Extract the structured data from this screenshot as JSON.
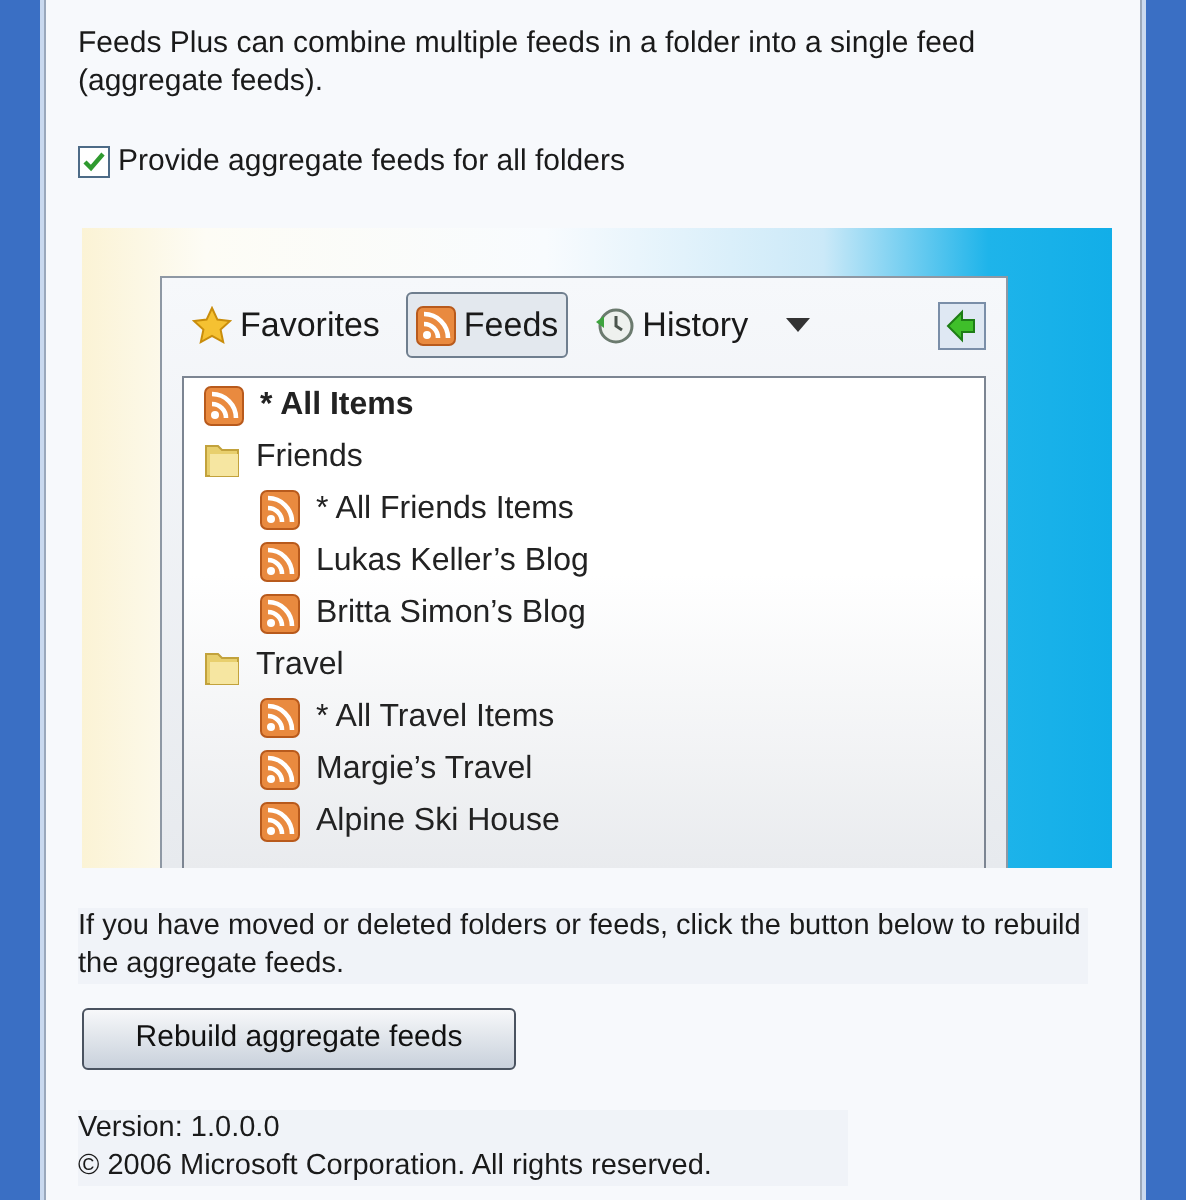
{
  "description": "Feeds Plus can combine multiple feeds in a folder into a single feed (aggregate feeds).",
  "aggregate_checkbox": {
    "label": "Provide aggregate feeds for all folders",
    "checked": true
  },
  "preview": {
    "tabs": [
      {
        "label": "Favorites",
        "kind": "star",
        "selected": false
      },
      {
        "label": "Feeds",
        "kind": "feed",
        "selected": true
      },
      {
        "label": "History",
        "kind": "clock",
        "selected": false
      }
    ],
    "tree": [
      {
        "label": "* All Items",
        "kind": "feed",
        "bold": true
      },
      {
        "label": "Friends",
        "kind": "folder",
        "bold": false,
        "children": [
          {
            "label": "* All Friends Items",
            "kind": "feed",
            "bold": false
          },
          {
            "label": "Lukas Keller’s Blog",
            "kind": "feed",
            "bold": false
          },
          {
            "label": "Britta Simon’s Blog",
            "kind": "feed",
            "bold": false
          }
        ]
      },
      {
        "label": "Travel",
        "kind": "folder",
        "bold": false,
        "children": [
          {
            "label": " * All Travel Items",
            "kind": "feed",
            "bold": false
          },
          {
            "label": "Margie’s Travel",
            "kind": "feed",
            "bold": false
          },
          {
            "label": "Alpine Ski House",
            "kind": "feed",
            "bold": false
          }
        ]
      }
    ]
  },
  "rebuild_note": "If you have moved or deleted folders or feeds, click the button below to rebuild the aggregate feeds.",
  "rebuild_button": "Rebuild aggregate feeds",
  "version": "Version: 1.0.0.0",
  "copyright": "© 2006 Microsoft Corporation. All rights reserved."
}
